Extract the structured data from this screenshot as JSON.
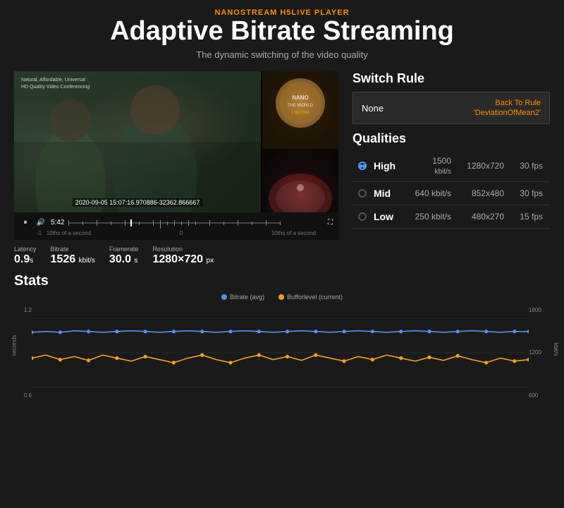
{
  "header": {
    "brand": "NANOSTREAM H5LIVE PLAYER",
    "title": "Adaptive Bitrate Streaming",
    "subtitle": "The dynamic switching of the video quality"
  },
  "video": {
    "timestamp": "2020-09-05 15:07:16.970886-32362.866667",
    "time_display": "5:42",
    "timeline_minus": "-1",
    "timeline_zero": "0",
    "timeline_label_left": "10ths of a second",
    "timeline_label_right": "10ths of a second",
    "banner_line1": "Natural, Affordable, Universal",
    "banner_line2": "HD Quality Video Conferencing"
  },
  "metrics": {
    "latency_label": "Latency",
    "latency_value": "0.9",
    "latency_unit": "s",
    "bitrate_label": "Bitrate",
    "bitrate_value": "1526",
    "bitrate_unit": "kbit/s",
    "framerate_label": "Framerate",
    "framerate_value": "30.0",
    "framerate_unit": "s",
    "resolution_label": "Resolution",
    "resolution_value": "1280×720",
    "resolution_unit": "px"
  },
  "switch_rule": {
    "title": "Switch Rule",
    "none_label": "None",
    "back_label": "Back To Rule\n'DeviationOfMean2'"
  },
  "qualities": {
    "title": "Qualities",
    "items": [
      {
        "name": "High",
        "bitrate": "1500 kbit/s",
        "resolution": "1280x720",
        "fps": "30 fps",
        "active": true
      },
      {
        "name": "Mid",
        "bitrate": "640 kbit/s",
        "resolution": "852x480",
        "fps": "30 fps",
        "active": false
      },
      {
        "name": "Low",
        "bitrate": "250 kbit/s",
        "resolution": "480x270",
        "fps": "15 fps",
        "active": false
      }
    ]
  },
  "stats": {
    "title": "Stats",
    "legend": [
      {
        "label": "Bitrate (avg)",
        "color": "#5a8ef5"
      },
      {
        "label": "Bufforlevel (current)",
        "color": "#f5a020"
      }
    ],
    "y_left_labels": [
      "1.2",
      "0.6"
    ],
    "y_right_labels": [
      "1800",
      "1200",
      "600"
    ],
    "y_left_axis": "seconds",
    "y_right_axis": "kbit/s"
  },
  "icons": {
    "play": "▶",
    "pause": "⏸",
    "volume": "🔊",
    "fullscreen": "⛶"
  }
}
